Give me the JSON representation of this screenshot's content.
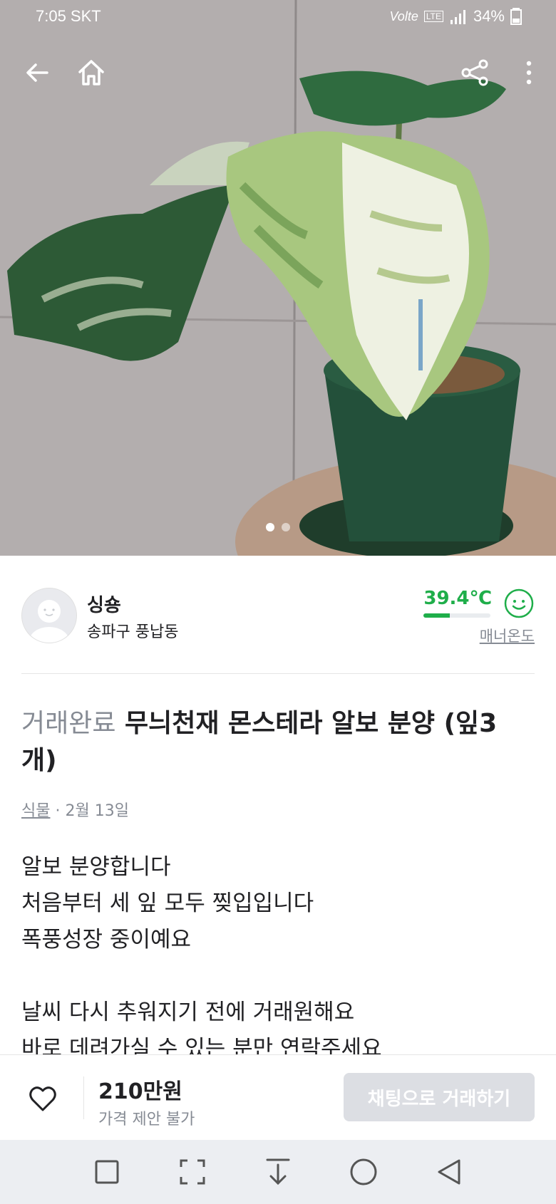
{
  "status_bar": {
    "time": "7:05 SKT",
    "network": "Volte",
    "lte": "LTE",
    "battery": "34%"
  },
  "top_actions": {
    "back_icon": "arrow-left-icon",
    "home_icon": "home-icon",
    "share_icon": "share-icon",
    "more_icon": "more-vertical-icon"
  },
  "gallery": {
    "image_count": 2,
    "active_index": 0
  },
  "seller": {
    "nickname": "싱숑",
    "region": "송파구 풍납동",
    "manner_temp": "39.4℃",
    "manner_temp_fraction": 0.394,
    "manner_label": "매너온도",
    "temp_color": "#1fae4a"
  },
  "post": {
    "status": "거래완료",
    "title": " 무늬천재 몬스테라 알보 분양 (잎3개)",
    "category": "식물",
    "date": " · 2월 13일",
    "description": "알보 분양합니다\n처음부터 세 잎 모두 찢입입니다\n폭풍성장 중이예요\n\n날씨 다시 추워지기 전에 거래원해요\n바로 데려가실 수 있는 분만 연락주세요"
  },
  "bottom": {
    "price": "210만원",
    "negotiation": "가격 제안 불가",
    "chat_button": "채팅으로 거래하기"
  },
  "nav": [
    "square-icon",
    "screenshot-icon",
    "download-icon",
    "circle-home-icon",
    "triangle-back-icon"
  ]
}
